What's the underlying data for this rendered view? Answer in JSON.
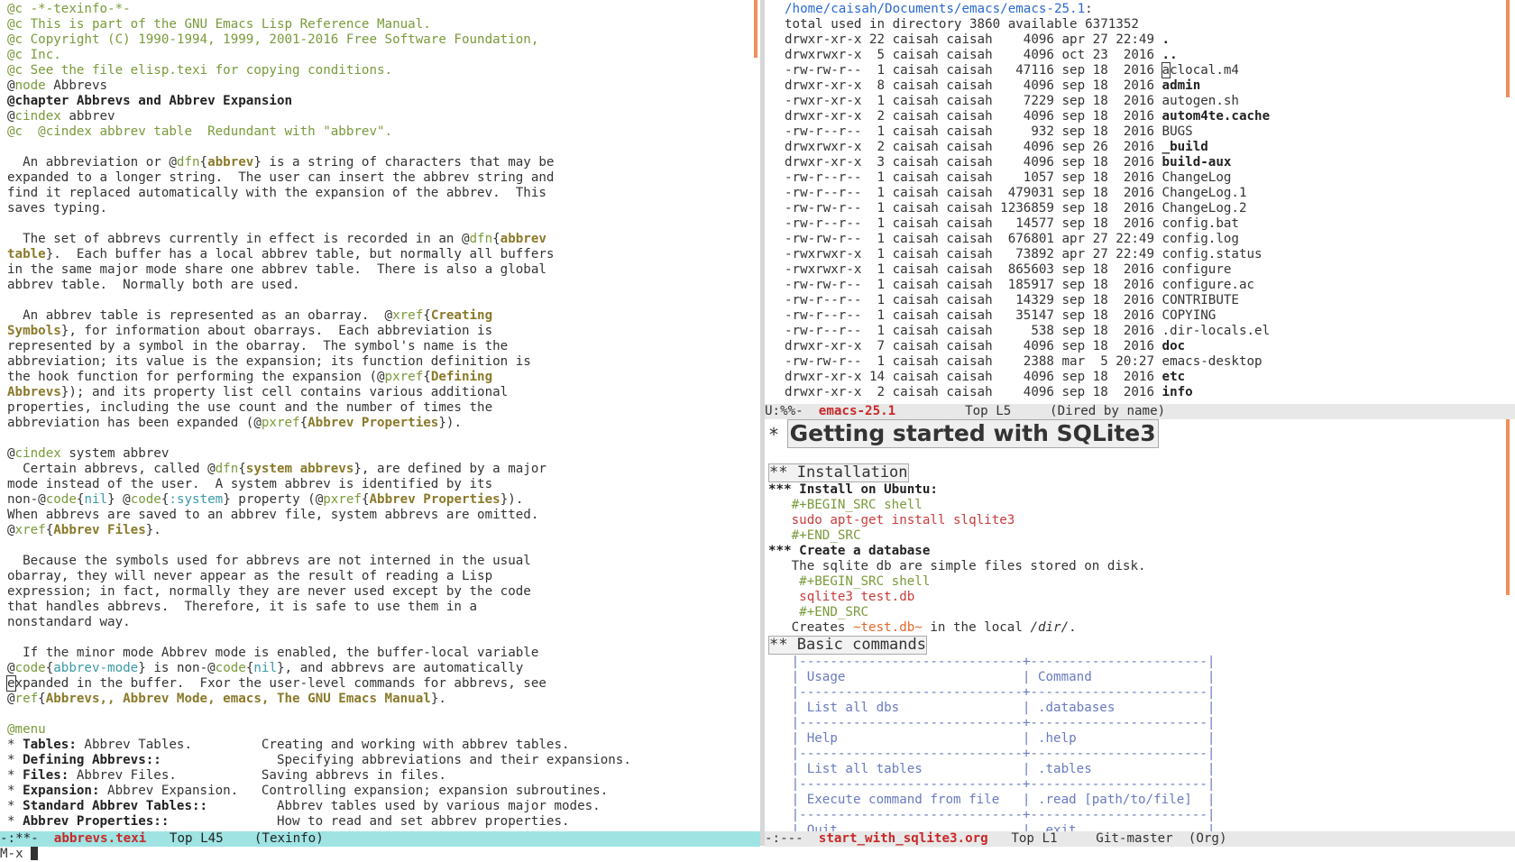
{
  "left": {
    "lines": [
      [
        {
          "t": "@c -*-texinfo-*-",
          "c": "cm"
        }
      ],
      [
        {
          "t": "@c This is part of the GNU Emacs Lisp Reference Manual.",
          "c": "cm"
        }
      ],
      [
        {
          "t": "@c Copyright (C) 1990-1994, 1999, 2001-2016 Free Software Foundation,",
          "c": "cm"
        }
      ],
      [
        {
          "t": "@c Inc.",
          "c": "cm"
        }
      ],
      [
        {
          "t": "@c See the file elisp.texi for copying conditions.",
          "c": "cm"
        }
      ],
      [
        {
          "t": "@",
          "c": ""
        },
        {
          "t": "node",
          "c": "kw"
        },
        {
          "t": " Abbrevs",
          "c": ""
        }
      ],
      [
        {
          "t": "@chapter Abbrevs and Abbrev Expansion",
          "c": "b"
        }
      ],
      [
        {
          "t": "@",
          "c": ""
        },
        {
          "t": "cindex",
          "c": "kw"
        },
        {
          "t": " abbrev",
          "c": ""
        }
      ],
      [
        {
          "t": "@c  @cindex abbrev table  Redundant with \"abbrev\".",
          "c": "cm"
        }
      ],
      [
        {
          "t": "",
          "c": ""
        }
      ],
      [
        {
          "t": "  An abbreviation or @",
          "c": ""
        },
        {
          "t": "dfn",
          "c": "kw"
        },
        {
          "t": "{",
          "c": ""
        },
        {
          "t": "abbrev",
          "c": "arg"
        },
        {
          "t": "} is a string of characters that may be",
          "c": ""
        }
      ],
      [
        {
          "t": "expanded to a longer string.  The user can insert the abbrev string and",
          "c": ""
        }
      ],
      [
        {
          "t": "find it replaced automatically with the expansion of the abbrev.  This",
          "c": ""
        }
      ],
      [
        {
          "t": "saves typing.",
          "c": ""
        }
      ],
      [
        {
          "t": "",
          "c": ""
        }
      ],
      [
        {
          "t": "  The set of abbrevs currently in effect is recorded in an @",
          "c": ""
        },
        {
          "t": "dfn",
          "c": "kw"
        },
        {
          "t": "{",
          "c": ""
        },
        {
          "t": "abbrev",
          "c": "arg"
        }
      ],
      [
        {
          "t": "table",
          "c": "arg"
        },
        {
          "t": "}.  Each buffer has a local abbrev table, but normally all buffers",
          "c": ""
        }
      ],
      [
        {
          "t": "in the same major mode share one abbrev table.  There is also a global",
          "c": ""
        }
      ],
      [
        {
          "t": "abbrev table.  Normally both are used.",
          "c": ""
        }
      ],
      [
        {
          "t": "",
          "c": ""
        }
      ],
      [
        {
          "t": "  An abbrev table is represented as an obarray.  @",
          "c": ""
        },
        {
          "t": "xref",
          "c": "kw"
        },
        {
          "t": "{",
          "c": ""
        },
        {
          "t": "Creating",
          "c": "arg"
        }
      ],
      [
        {
          "t": "Symbols",
          "c": "arg"
        },
        {
          "t": "}, for information about obarrays.  Each abbreviation is",
          "c": ""
        }
      ],
      [
        {
          "t": "represented by a symbol in the obarray.  The symbol's name is the",
          "c": ""
        }
      ],
      [
        {
          "t": "abbreviation; its value is the expansion; its function definition is",
          "c": ""
        }
      ],
      [
        {
          "t": "the hook function for performing the expansion (@",
          "c": ""
        },
        {
          "t": "pxref",
          "c": "kw"
        },
        {
          "t": "{",
          "c": ""
        },
        {
          "t": "Defining",
          "c": "arg"
        }
      ],
      [
        {
          "t": "Abbrevs",
          "c": "arg"
        },
        {
          "t": "}); and its property list cell contains various additional",
          "c": ""
        }
      ],
      [
        {
          "t": "properties, including the use count and the number of times the",
          "c": ""
        }
      ],
      [
        {
          "t": "abbreviation has been expanded (@",
          "c": ""
        },
        {
          "t": "pxref",
          "c": "kw"
        },
        {
          "t": "{",
          "c": ""
        },
        {
          "t": "Abbrev Properties",
          "c": "arg"
        },
        {
          "t": "}).",
          "c": ""
        }
      ],
      [
        {
          "t": "",
          "c": ""
        }
      ],
      [
        {
          "t": "@",
          "c": ""
        },
        {
          "t": "cindex",
          "c": "kw"
        },
        {
          "t": " system abbrev",
          "c": ""
        }
      ],
      [
        {
          "t": "  Certain abbrevs, called @",
          "c": ""
        },
        {
          "t": "dfn",
          "c": "kw"
        },
        {
          "t": "{",
          "c": ""
        },
        {
          "t": "system abbrevs",
          "c": "arg"
        },
        {
          "t": "}, are defined by a major",
          "c": ""
        }
      ],
      [
        {
          "t": "mode instead of the user.  A system abbrev is identified by its",
          "c": ""
        }
      ],
      [
        {
          "t": "non-@",
          "c": ""
        },
        {
          "t": "code",
          "c": "kw"
        },
        {
          "t": "{",
          "c": ""
        },
        {
          "t": "nil",
          "c": "cd"
        },
        {
          "t": "} @",
          "c": ""
        },
        {
          "t": "code",
          "c": "kw"
        },
        {
          "t": "{",
          "c": ""
        },
        {
          "t": ":system",
          "c": "cd"
        },
        {
          "t": "} property (@",
          "c": ""
        },
        {
          "t": "pxref",
          "c": "kw"
        },
        {
          "t": "{",
          "c": ""
        },
        {
          "t": "Abbrev Properties",
          "c": "arg"
        },
        {
          "t": "}).",
          "c": ""
        }
      ],
      [
        {
          "t": "When abbrevs are saved to an abbrev file, system abbrevs are omitted.",
          "c": ""
        }
      ],
      [
        {
          "t": "@",
          "c": ""
        },
        {
          "t": "xref",
          "c": "kw"
        },
        {
          "t": "{",
          "c": ""
        },
        {
          "t": "Abbrev Files",
          "c": "arg"
        },
        {
          "t": "}.",
          "c": ""
        }
      ],
      [
        {
          "t": "",
          "c": ""
        }
      ],
      [
        {
          "t": "  Because the symbols used for abbrevs are not interned in the usual",
          "c": ""
        }
      ],
      [
        {
          "t": "obarray, they will never appear as the result of reading a Lisp",
          "c": ""
        }
      ],
      [
        {
          "t": "expression; in fact, normally they are never used except by the code",
          "c": ""
        }
      ],
      [
        {
          "t": "that handles abbrevs.  Therefore, it is safe to use them in a",
          "c": ""
        }
      ],
      [
        {
          "t": "nonstandard way.",
          "c": ""
        }
      ],
      [
        {
          "t": "",
          "c": ""
        }
      ],
      [
        {
          "t": "  If the minor mode Abbrev mode is enabled, the buffer-local variable",
          "c": ""
        }
      ],
      [
        {
          "t": "@",
          "c": ""
        },
        {
          "t": "code",
          "c": "kw"
        },
        {
          "t": "{",
          "c": ""
        },
        {
          "t": "abbrev-mode",
          "c": "cd"
        },
        {
          "t": "} is non-@",
          "c": ""
        },
        {
          "t": "code",
          "c": "kw"
        },
        {
          "t": "{",
          "c": ""
        },
        {
          "t": "nil",
          "c": "cd"
        },
        {
          "t": "}, and abbrevs are automatically",
          "c": ""
        }
      ],
      [
        {
          "t": "e",
          "c": "boxcur"
        },
        {
          "t": "xpanded in the buffer.  Fxor the user-level commands for abbrevs, see",
          "c": ""
        }
      ],
      [
        {
          "t": "@",
          "c": ""
        },
        {
          "t": "ref",
          "c": "kw"
        },
        {
          "t": "{",
          "c": ""
        },
        {
          "t": "Abbrevs,, Abbrev Mode, emacs, The GNU Emacs Manual",
          "c": "arg"
        },
        {
          "t": "}.",
          "c": ""
        }
      ],
      [
        {
          "t": "",
          "c": ""
        }
      ],
      [
        {
          "t": "@menu",
          "c": "at"
        }
      ],
      [
        {
          "t": "* ",
          "c": ""
        },
        {
          "t": "Tables:",
          "c": "b"
        },
        {
          "t": " Abbrev Tables.         Creating and working with abbrev tables.",
          "c": ""
        }
      ],
      [
        {
          "t": "* ",
          "c": ""
        },
        {
          "t": "Defining Abbrevs::",
          "c": "b"
        },
        {
          "t": "               Specifying abbreviations and their expansions.",
          "c": ""
        }
      ],
      [
        {
          "t": "* ",
          "c": ""
        },
        {
          "t": "Files:",
          "c": "b"
        },
        {
          "t": " Abbrev Files.           Saving abbrevs in files.",
          "c": ""
        }
      ],
      [
        {
          "t": "* ",
          "c": ""
        },
        {
          "t": "Expansion:",
          "c": "b"
        },
        {
          "t": " Abbrev Expansion.   Controlling expansion; expansion subroutines.",
          "c": ""
        }
      ],
      [
        {
          "t": "* ",
          "c": ""
        },
        {
          "t": "Standard Abbrev Tables::",
          "c": "b"
        },
        {
          "t": "         Abbrev tables used by various major modes.",
          "c": ""
        }
      ],
      [
        {
          "t": "* ",
          "c": ""
        },
        {
          "t": "Abbrev Properties::",
          "c": "b"
        },
        {
          "t": "              How to read and set abbrev properties.",
          "c": ""
        }
      ]
    ],
    "modeline": {
      "status": "-:**-  ",
      "buffer": "abbrevs.texi",
      "rest": "   Top L45    (Texinfo)"
    }
  },
  "dired": {
    "header": "/home/caisah/Documents/emacs/emacs-25.1",
    "lines": [
      [
        {
          "t": "total used in directory 3860 available 6371352",
          "c": ""
        }
      ],
      [
        {
          "t": "drwxr-xr-x 22 caisah caisah    4096 apr 27 22:49 ",
          "c": ""
        },
        {
          "t": ".",
          "c": "dir"
        }
      ],
      [
        {
          "t": "drwxrwxr-x  5 caisah caisah    4096 oct 23  2016 ",
          "c": ""
        },
        {
          "t": "..",
          "c": "dir"
        }
      ],
      [
        {
          "t": "-rw-rw-r--  1 caisah caisah   47116 sep 18  2016 ",
          "c": ""
        },
        {
          "t": "a",
          "c": "boxcur"
        },
        {
          "t": "clocal.m4",
          "c": ""
        }
      ],
      [
        {
          "t": "drwxr-xr-x  8 caisah caisah    4096 sep 18  2016 ",
          "c": ""
        },
        {
          "t": "admin",
          "c": "dir"
        }
      ],
      [
        {
          "t": "-rwxr-xr-x  1 caisah caisah    7229 sep 18  2016 autogen.sh",
          "c": ""
        }
      ],
      [
        {
          "t": "drwxr-xr-x  2 caisah caisah    4096 sep 18  2016 ",
          "c": ""
        },
        {
          "t": "autom4te.cache",
          "c": "dir"
        }
      ],
      [
        {
          "t": "-rw-r--r--  1 caisah caisah     932 sep 18  2016 BUGS",
          "c": ""
        }
      ],
      [
        {
          "t": "drwxrwxr-x  2 caisah caisah    4096 sep 26  2016 ",
          "c": ""
        },
        {
          "t": "_build",
          "c": "dir"
        }
      ],
      [
        {
          "t": "drwxr-xr-x  3 caisah caisah    4096 sep 18  2016 ",
          "c": ""
        },
        {
          "t": "build-aux",
          "c": "dir"
        }
      ],
      [
        {
          "t": "-rw-r--r--  1 caisah caisah    1057 sep 18  2016 ChangeLog",
          "c": ""
        }
      ],
      [
        {
          "t": "-rw-r--r--  1 caisah caisah  479031 sep 18  2016 ChangeLog.1",
          "c": ""
        }
      ],
      [
        {
          "t": "-rw-rw-r--  1 caisah caisah 1236859 sep 18  2016 ChangeLog.2",
          "c": ""
        }
      ],
      [
        {
          "t": "-rw-r--r--  1 caisah caisah   14577 sep 18  2016 config.bat",
          "c": ""
        }
      ],
      [
        {
          "t": "-rw-rw-r--  1 caisah caisah  676801 apr 27 22:49 config.log",
          "c": ""
        }
      ],
      [
        {
          "t": "-rwxrwxr-x  1 caisah caisah   73892 apr 27 22:49 config.status",
          "c": ""
        }
      ],
      [
        {
          "t": "-rwxrwxr-x  1 caisah caisah  865603 sep 18  2016 configure",
          "c": ""
        }
      ],
      [
        {
          "t": "-rw-rw-r--  1 caisah caisah  185917 sep 18  2016 configure.ac",
          "c": ""
        }
      ],
      [
        {
          "t": "-rw-r--r--  1 caisah caisah   14329 sep 18  2016 CONTRIBUTE",
          "c": ""
        }
      ],
      [
        {
          "t": "-rw-r--r--  1 caisah caisah   35147 sep 18  2016 COPYING",
          "c": ""
        }
      ],
      [
        {
          "t": "-rw-r--r--  1 caisah caisah     538 sep 18  2016 .dir-locals.el",
          "c": ""
        }
      ],
      [
        {
          "t": "drwxr-xr-x  7 caisah caisah    4096 sep 18  2016 ",
          "c": ""
        },
        {
          "t": "doc",
          "c": "dir"
        }
      ],
      [
        {
          "t": "-rw-rw-r--  1 caisah caisah    2388 mar  5 20:27 emacs-desktop",
          "c": ""
        }
      ],
      [
        {
          "t": "drwxr-xr-x 14 caisah caisah    4096 sep 18  2016 ",
          "c": ""
        },
        {
          "t": "etc",
          "c": "dir"
        }
      ],
      [
        {
          "t": "drwxr-xr-x  2 caisah caisah    4096 sep 18  2016 ",
          "c": ""
        },
        {
          "t": "info",
          "c": "dir"
        }
      ]
    ],
    "modeline": {
      "status": "U:%%-  ",
      "buffer": "emacs-25.1",
      "rest": "         Top L5     (Dired by name)"
    }
  },
  "org": {
    "title_star": "*",
    "title": "Getting started with SQLite3",
    "lines": [
      [
        {
          "t": "",
          "c": ""
        }
      ],
      [
        {
          "t": "** Installation",
          "c": "oh2"
        }
      ],
      [
        {
          "t": "*** Install on Ubuntu:",
          "c": "oh3"
        }
      ],
      [
        {
          "t": "   #+BEGIN_SRC shell",
          "c": "meta"
        }
      ],
      [
        {
          "t": "   sudo apt-get install slqlite3",
          "c": "src"
        }
      ],
      [
        {
          "t": "   #+END_SRC",
          "c": "meta"
        }
      ],
      [
        {
          "t": "*** Create a database",
          "c": "oh3"
        }
      ],
      [
        {
          "t": "   The sqlite db are simple files stored on disk.",
          "c": ""
        }
      ],
      [
        {
          "t": "    #+BEGIN_SRC shell",
          "c": "meta"
        }
      ],
      [
        {
          "t": "    sqlite3 test.db",
          "c": "src"
        }
      ],
      [
        {
          "t": "    #+END_SRC",
          "c": "meta"
        }
      ],
      [
        {
          "t": "   Creates ",
          "c": ""
        },
        {
          "t": "~test.db~",
          "c": "verb"
        },
        {
          "t": " in the local ",
          "c": ""
        },
        {
          "t": "/dir/",
          "c": "it"
        },
        {
          "t": ".",
          "c": ""
        }
      ],
      [
        {
          "t": "** Basic commands",
          "c": "oh2"
        }
      ],
      [
        {
          "t": "   |-----------------------------+-----------------------|",
          "c": "tbl"
        }
      ],
      [
        {
          "t": "   | Usage                       | Command               |",
          "c": "tbl"
        }
      ],
      [
        {
          "t": "   |-----------------------------+-----------------------|",
          "c": "tbl"
        }
      ],
      [
        {
          "t": "   | List all dbs                | .databases            |",
          "c": "tbl"
        }
      ],
      [
        {
          "t": "   |-----------------------------+-----------------------|",
          "c": "tbl"
        }
      ],
      [
        {
          "t": "   | Help                        | .help                 |",
          "c": "tbl"
        }
      ],
      [
        {
          "t": "   |-----------------------------+-----------------------|",
          "c": "tbl"
        }
      ],
      [
        {
          "t": "   | List all tables             | .tables               |",
          "c": "tbl"
        }
      ],
      [
        {
          "t": "   |-----------------------------+-----------------------|",
          "c": "tbl"
        }
      ],
      [
        {
          "t": "   | Execute command from file   | .read [path/to/file]  |",
          "c": "tbl"
        }
      ],
      [
        {
          "t": "   |-----------------------------+-----------------------|",
          "c": "tbl"
        }
      ],
      [
        {
          "t": "   | Quit                        | .exit                 |",
          "c": "tbl"
        }
      ]
    ],
    "modeline": {
      "status": "-:---  ",
      "buffer": "start_with_sqlite3.org",
      "rest": "   Top L1     Git-master  (Org)"
    }
  },
  "minibuffer": {
    "prompt": "M-x "
  }
}
